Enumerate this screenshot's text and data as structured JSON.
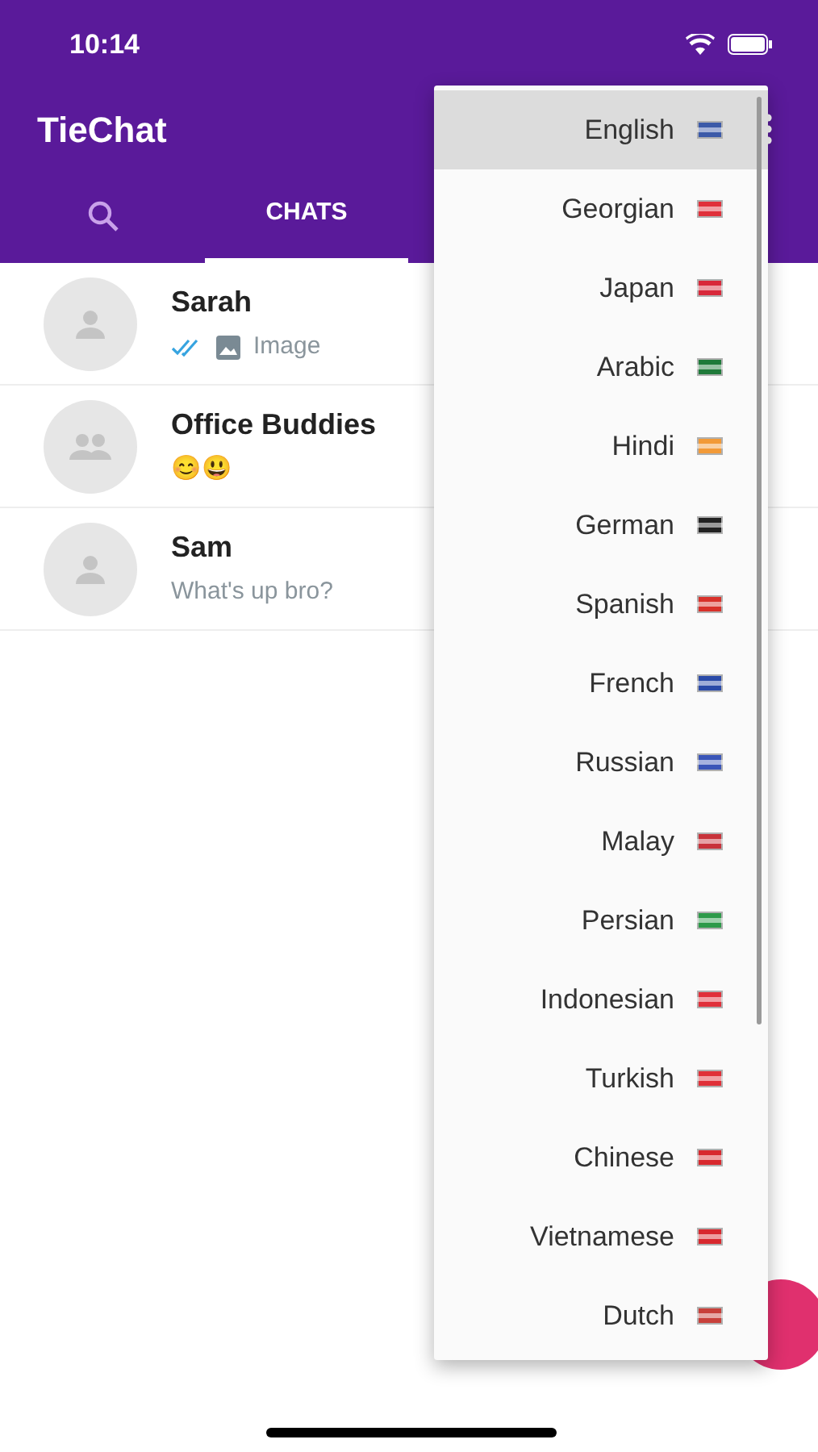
{
  "status_bar": {
    "time": "10:14"
  },
  "app_bar": {
    "title": "TieChat"
  },
  "tabs": [
    {
      "label": "CHATS",
      "selected": true
    }
  ],
  "chats": [
    {
      "name": "Sarah",
      "kind": "image",
      "preview": "Image",
      "group": false
    },
    {
      "name": "Office Buddies",
      "kind": "text",
      "preview": "😊😃",
      "group": true
    },
    {
      "name": "Sam",
      "kind": "text",
      "preview": "What's up bro?",
      "group": false
    }
  ],
  "language_menu": [
    {
      "label": "English",
      "selected": true,
      "color": "#3c5aa8"
    },
    {
      "label": "Georgian",
      "selected": false,
      "color": "#e0303a"
    },
    {
      "label": "Japan",
      "selected": false,
      "color": "#d8283a"
    },
    {
      "label": "Arabic",
      "selected": false,
      "color": "#1f7a3a"
    },
    {
      "label": "Hindi",
      "selected": false,
      "color": "#f29a38"
    },
    {
      "label": "German",
      "selected": false,
      "color": "#222222"
    },
    {
      "label": "Spanish",
      "selected": false,
      "color": "#d8312a"
    },
    {
      "label": "French",
      "selected": false,
      "color": "#2a4aa8"
    },
    {
      "label": "Russian",
      "selected": false,
      "color": "#3a55b8"
    },
    {
      "label": "Malay",
      "selected": false,
      "color": "#c8323a"
    },
    {
      "label": "Persian",
      "selected": false,
      "color": "#2e9a4a"
    },
    {
      "label": "Indonesian",
      "selected": false,
      "color": "#e0303a"
    },
    {
      "label": "Turkish",
      "selected": false,
      "color": "#e03038"
    },
    {
      "label": "Chinese",
      "selected": false,
      "color": "#d8282e"
    },
    {
      "label": "Vietnamese",
      "selected": false,
      "color": "#d8282e"
    },
    {
      "label": "Dutch",
      "selected": false,
      "color": "#c8403a"
    }
  ]
}
